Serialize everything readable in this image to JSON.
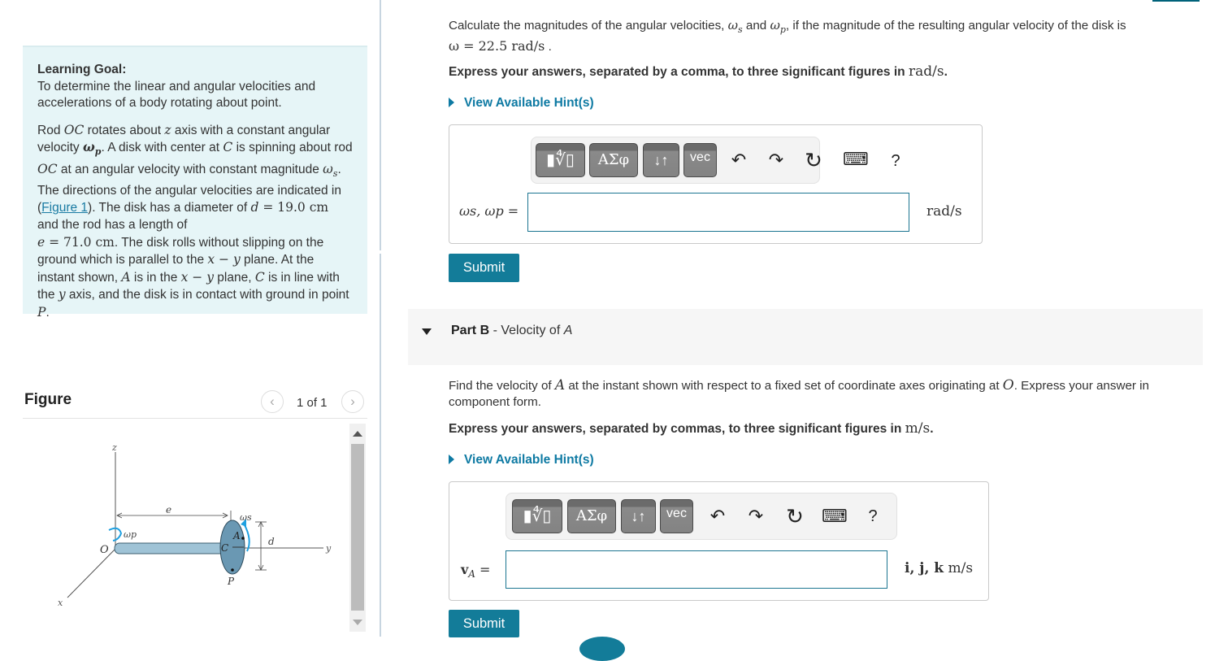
{
  "learning_goal": {
    "title": "Learning Goal:",
    "text": "To determine the linear and angular velocities and accelerations of a body rotating about point.",
    "description": {
      "p1": "Rod ",
      "OC": "OC",
      "p2": " rotates about ",
      "z": "z",
      "p3": " axis with a constant angular velocity ",
      "wp": "ω",
      "wp_sub": "p",
      "p4": ". A disk with center at ",
      "C": "C",
      "p5": " is spinning about rod ",
      "OC2": "OC",
      "p6": " at an angular velocity with constant magnitude ",
      "ws": "ω",
      "ws_sub": "s",
      "p7": ". The directions of the angular velocities are indicated in (",
      "figure_link": "Figure 1",
      "p8": "). The disk has a diameter of ",
      "d_eq": "d",
      "d_val": " = 19.0 cm",
      "p9": " and the rod has a length of ",
      "e_eq": "e",
      "e_val": " = 71.0 cm",
      "p10": ". The disk rolls without slipping on the ground which is parallel to the ",
      "xy1": "x − y",
      "p11": " plane. At the instant shown, ",
      "A": "A",
      "p12": " is in the ",
      "xy2": "x − y",
      "p13": " plane, ",
      "C2": "C",
      "p14": " is in line with the ",
      "y": "y",
      "p15": " axis, and the disk is in contact with ground in point ",
      "P": "P",
      "p16": "."
    }
  },
  "figure": {
    "title": "Figure",
    "page_count": "1 of 1",
    "prev_icon": "‹",
    "next_icon": "›",
    "labels": {
      "z": "z",
      "y": "y",
      "x": "x",
      "O": "O",
      "C": "C",
      "A": "A",
      "P": "P",
      "e": "e",
      "d": "d",
      "wp": "ωp",
      "ws": "ωs"
    }
  },
  "part_a": {
    "question_p1": "Calculate the magnitudes of the angular velocities, ",
    "ws": "ω",
    "ws_sub": "s",
    "and": " and ",
    "wp": "ω",
    "wp_sub": "p",
    "question_p2": ", if the magnitude of the resulting angular velocity of the disk is",
    "omega_eq": "ω = 22.5 rad/s",
    "period": " .",
    "instruction": "Express your answers, separated by a comma, to three significant figures in ",
    "instruction_unit": "rad/s",
    "instruction_end": ".",
    "hint": "View Available Hint(s)",
    "answer_label": "ωs, ωp =",
    "answer_value": "",
    "answer_unit": "rad/s",
    "submit": "Submit"
  },
  "toolbar": {
    "templates": "▮∜▯",
    "greek": "ΑΣφ",
    "arrows": "↓↑",
    "vec": "vec",
    "undo": "↶",
    "redo": "↷",
    "reset": "↻",
    "keyboard": "⌨",
    "help": "?"
  },
  "part_b": {
    "label": "Part B",
    "sep": " - ",
    "title": "Velocity of ",
    "title_var": "A",
    "question_p1": "Find the velocity of ",
    "A": "A",
    "question_p2": " at the instant shown with respect to a fixed set of coordinate axes originating at ",
    "O": "O",
    "question_p3": ". Express your answer in component form.",
    "instruction": "Express your answers, separated by commas, to three significant figures in ",
    "instruction_unit": "m/s",
    "instruction_end": ".",
    "hint": "View Available Hint(s)",
    "answer_label_v": "v",
    "answer_label_sub": "A",
    "answer_label_eq": " =",
    "answer_value": "",
    "answer_unit_vec": "i, j, k",
    "answer_unit": " m/s",
    "submit": "Submit"
  }
}
